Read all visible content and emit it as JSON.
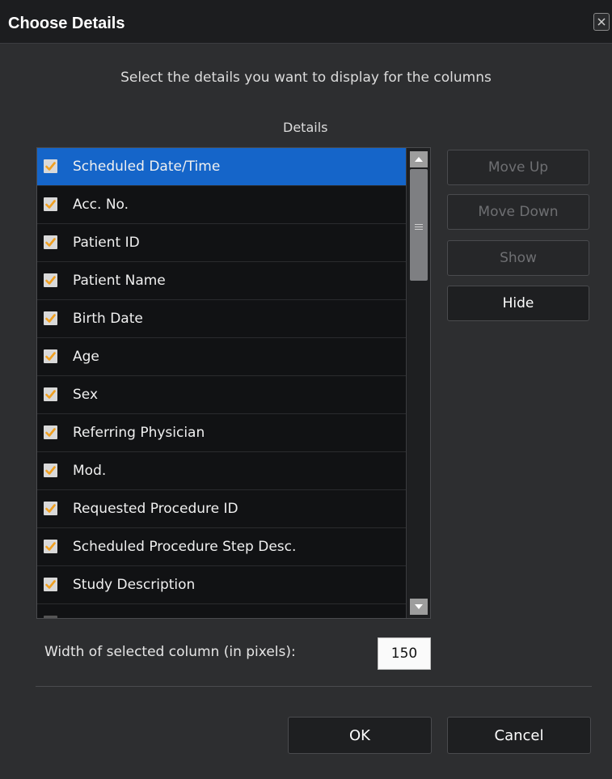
{
  "window": {
    "title": "Choose Details",
    "close_icon": "close-icon"
  },
  "instruction": "Select the details you want to display for the columns",
  "details_header": "Details",
  "details_list": [
    {
      "label": "Scheduled Date/Time",
      "checked": true,
      "selected": true
    },
    {
      "label": "Acc. No.",
      "checked": true,
      "selected": false
    },
    {
      "label": "Patient ID",
      "checked": true,
      "selected": false
    },
    {
      "label": "Patient Name",
      "checked": true,
      "selected": false
    },
    {
      "label": "Birth Date",
      "checked": true,
      "selected": false
    },
    {
      "label": "Age",
      "checked": true,
      "selected": false
    },
    {
      "label": "Sex",
      "checked": true,
      "selected": false
    },
    {
      "label": "Referring Physician",
      "checked": true,
      "selected": false
    },
    {
      "label": "Mod.",
      "checked": true,
      "selected": false
    },
    {
      "label": "Requested Procedure ID",
      "checked": true,
      "selected": false
    },
    {
      "label": "Scheduled Procedure Step Desc.",
      "checked": true,
      "selected": false
    },
    {
      "label": "Study Description",
      "checked": true,
      "selected": false
    }
  ],
  "side_buttons": {
    "move_up": "Move Up",
    "move_down": "Move Down",
    "show": "Show",
    "hide": "Hide"
  },
  "width_field": {
    "label": "Width of selected column (in pixels):",
    "value": "150"
  },
  "footer": {
    "ok": "OK",
    "cancel": "Cancel"
  },
  "colors": {
    "selected_row": "#1565c9",
    "checkmark": "#f0a021",
    "background": "#2d2e30"
  }
}
